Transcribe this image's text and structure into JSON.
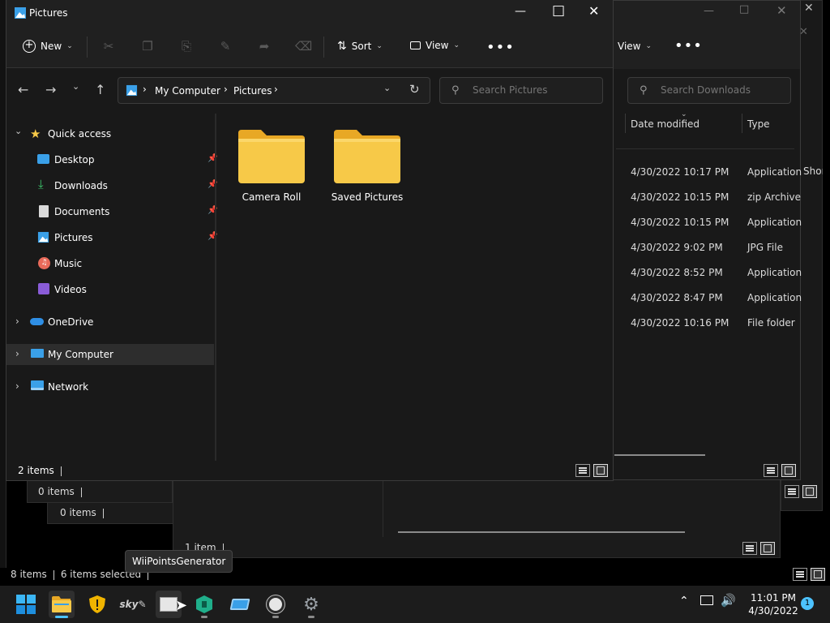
{
  "background_windows": {
    "status_a": "0 items",
    "status_b": "0 items",
    "status_c": "1 item",
    "desktop_status": {
      "items": "8 items",
      "selected": "6 items selected"
    }
  },
  "downloads_window": {
    "view_label": "View",
    "search_placeholder": "Search Downloads",
    "columns": {
      "date": "Date modified",
      "type": "Type"
    },
    "rows": [
      {
        "date": "4/30/2022 10:17 PM",
        "type": "Application"
      },
      {
        "date": "4/30/2022 10:15 PM",
        "type": "zip Archive"
      },
      {
        "date": "4/30/2022 10:15 PM",
        "type": "Application"
      },
      {
        "date": "4/30/2022 9:02 PM",
        "type": "JPG File"
      },
      {
        "date": "4/30/2022 8:52 PM",
        "type": "Application"
      },
      {
        "date": "4/30/2022 8:47 PM",
        "type": "Application"
      },
      {
        "date": "4/30/2022 10:16 PM",
        "type": "File folder"
      }
    ],
    "clipped_text": "Shoı"
  },
  "main_window": {
    "title": "Pictures",
    "toolbar": {
      "new": "New",
      "sort": "Sort",
      "view": "View"
    },
    "breadcrumb": [
      "My Computer",
      "Pictures"
    ],
    "search_placeholder": "Search Pictures",
    "sidebar": {
      "quick_access": "Quick access",
      "items": [
        {
          "label": "Desktop"
        },
        {
          "label": "Downloads"
        },
        {
          "label": "Documents"
        },
        {
          "label": "Pictures"
        },
        {
          "label": "Music"
        },
        {
          "label": "Videos"
        }
      ],
      "onedrive": "OneDrive",
      "my_computer": "My Computer",
      "network": "Network"
    },
    "folders": [
      {
        "name": "Camera Roll"
      },
      {
        "name": "Saved Pictures"
      }
    ],
    "status": "2 items"
  },
  "tooltip": "WiiPointsGenerator",
  "taskbar": {
    "time": "11:01 PM",
    "date": "4/30/2022",
    "notification_count": "1"
  },
  "colors": {
    "accent": "#4cc2ff",
    "folder": "#f7c948"
  }
}
